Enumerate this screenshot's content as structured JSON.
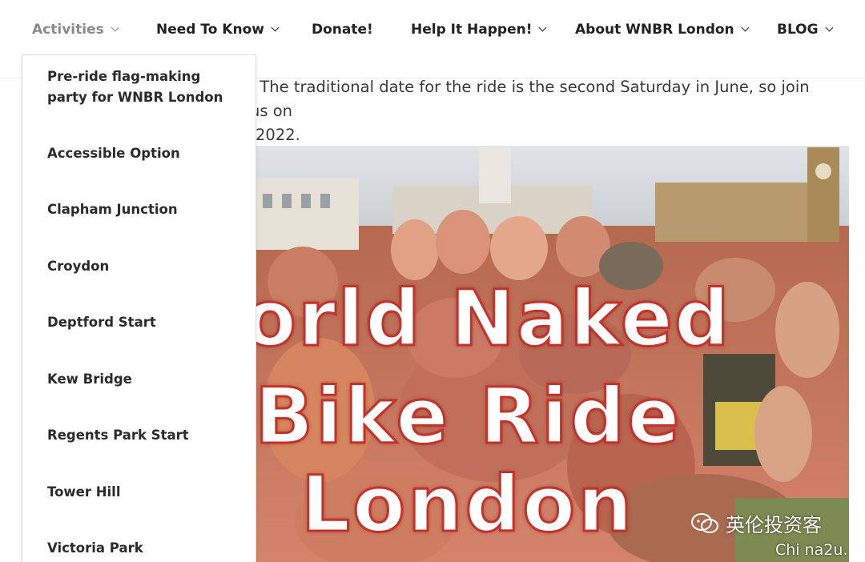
{
  "nav": {
    "items": [
      {
        "label": "Activities",
        "has_dropdown": true,
        "active": true
      },
      {
        "label": "Need To Know",
        "has_dropdown": true
      },
      {
        "label": "Donate!",
        "has_dropdown": false
      },
      {
        "label": "Help It Happen!",
        "has_dropdown": true
      },
      {
        "label": "About WNBR London",
        "has_dropdown": true
      },
      {
        "label": "BLOG",
        "has_dropdown": true
      }
    ]
  },
  "dropdown": {
    "items": [
      "Pre-ride flag-making party for WNBR London",
      "Accessible Option",
      "Clapham Junction",
      "Croydon",
      "Deptford Start",
      "Kew Bridge",
      "Regents Park Start",
      "Tower Hill",
      "Victoria Park"
    ]
  },
  "intro": {
    "line1": ". The traditional date for the ride is the second Saturday in June, so join us on",
    "line2": "2022."
  },
  "hero": {
    "line1": "orld Naked",
    "line2": "Bike Ride",
    "line3": "London"
  },
  "watermark": {
    "text": "英伦投资客",
    "sub": "Chi na2u."
  },
  "colors": {
    "nav_text": "#222222",
    "nav_active": "#8a8a8a",
    "title_outline": "#c4332b"
  }
}
